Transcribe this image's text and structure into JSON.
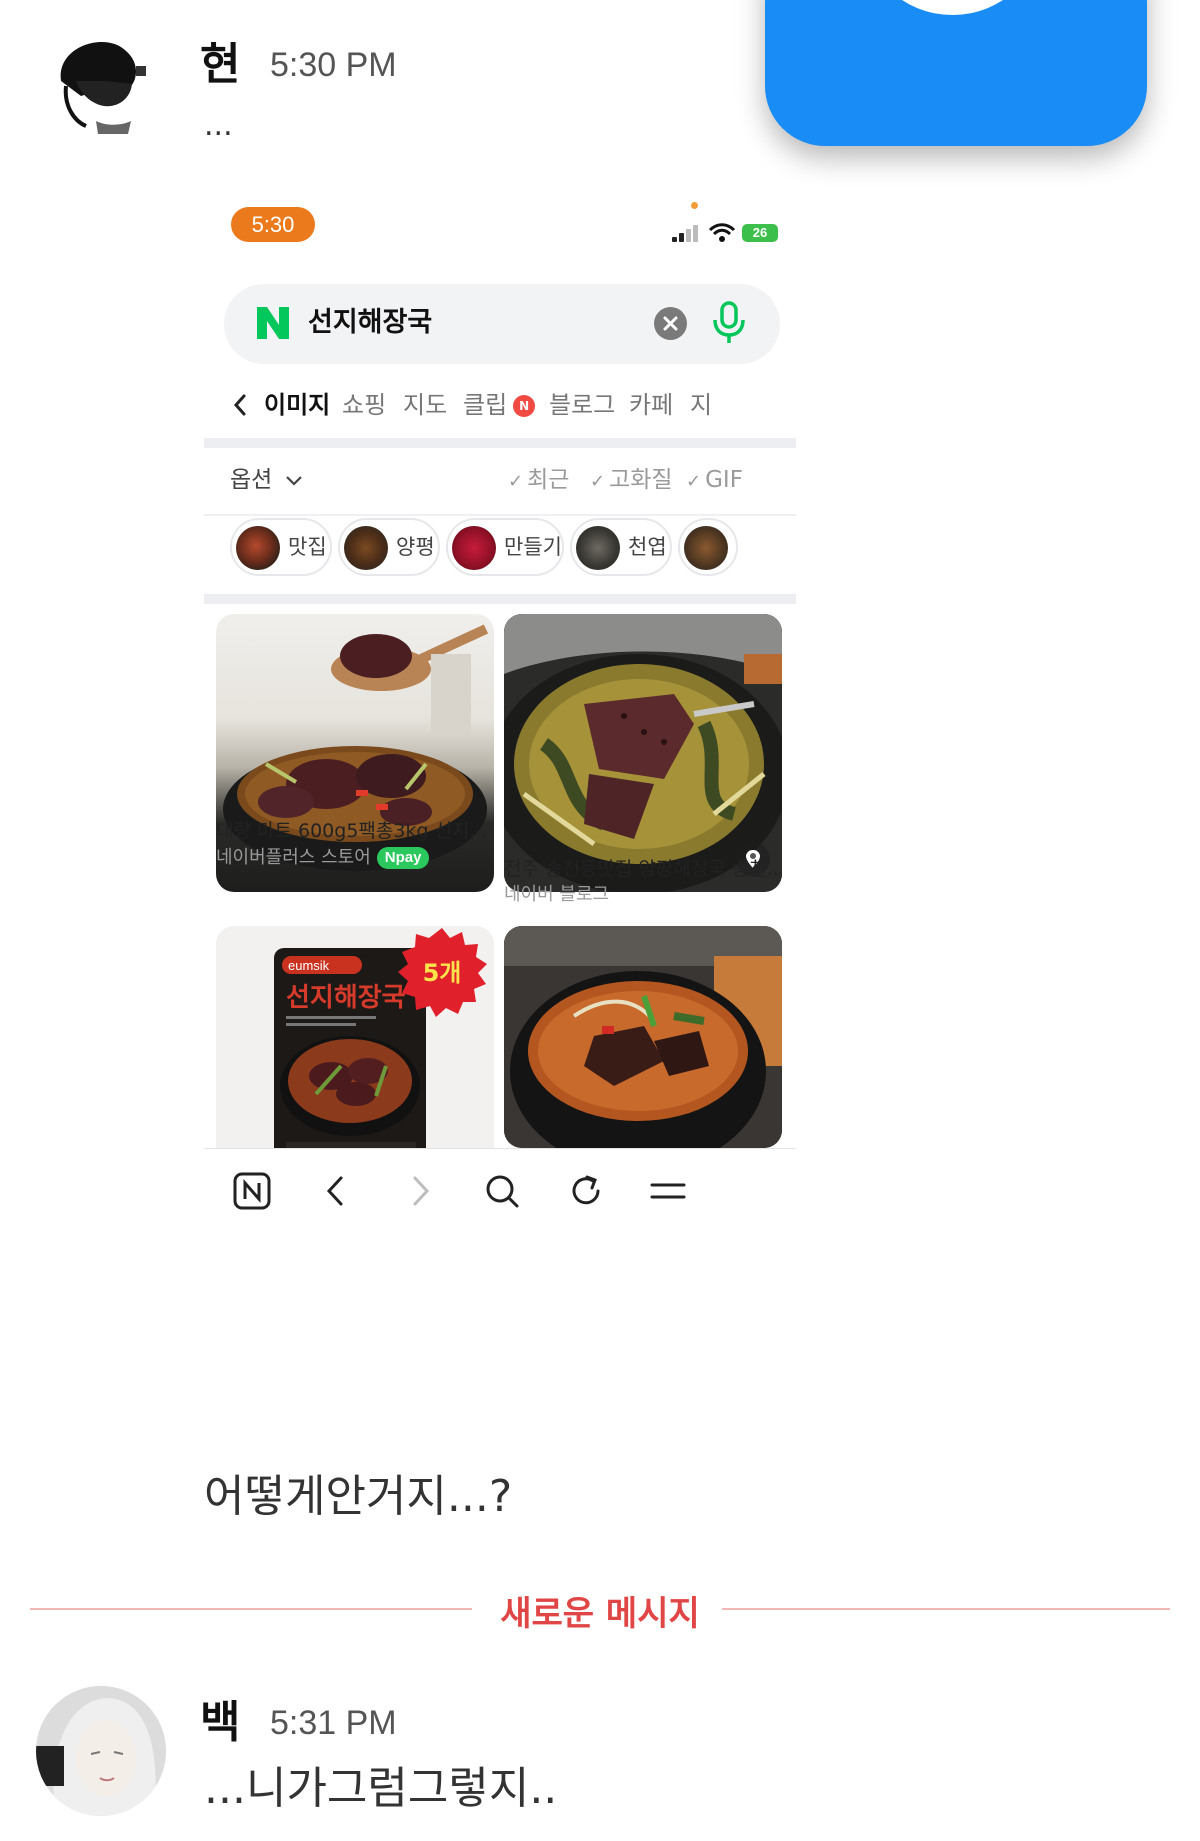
{
  "messages": [
    {
      "sender": "현",
      "time": "5:30 PM",
      "text": "..."
    },
    {
      "text": "어떻게안거지...?"
    },
    {
      "sender": "백",
      "time": "5:31 PM",
      "text": "...니가그럼그렇지.."
    }
  ],
  "new_message_divider": "새로운 메시지",
  "phone": {
    "status_time": "5:30",
    "battery": "26",
    "search_query": "선지해장국",
    "tabs": [
      "이미지",
      "쇼핑",
      "지도",
      "클립",
      "블로그",
      "카페",
      "지"
    ],
    "clip_badge": "N",
    "options_label": "옵션",
    "filters": [
      "최근",
      "고화질",
      "GIF"
    ],
    "chips": [
      "맛집",
      "양평",
      "만들기",
      "천엽"
    ],
    "results": [
      {
        "title": "대량 마트 600g5팩총3kg 선지...",
        "source": "네이버플러스 스토어",
        "badge": "Npay"
      },
      {
        "title": "전주 송천동맛집 양평해장국 송천...",
        "source": "네이버 블로그"
      },
      {
        "badge": "5개",
        "package_brand": "eumsik",
        "package_text": "선지해장국"
      },
      {}
    ]
  },
  "colors": {
    "accent_red": "#e04646",
    "naver_green": "#03c75a",
    "status_orange": "#ea7a1b",
    "app_icon_blue": "#1a8cf5"
  },
  "icons": [
    "naver-n-icon",
    "clear-icon",
    "mic-icon",
    "back-chevron-icon",
    "chevron-down-icon",
    "location-pin-icon",
    "naver-home-icon",
    "nav-back-icon",
    "nav-forward-icon",
    "search-icon",
    "refresh-icon",
    "menu-icon",
    "document-icon"
  ]
}
